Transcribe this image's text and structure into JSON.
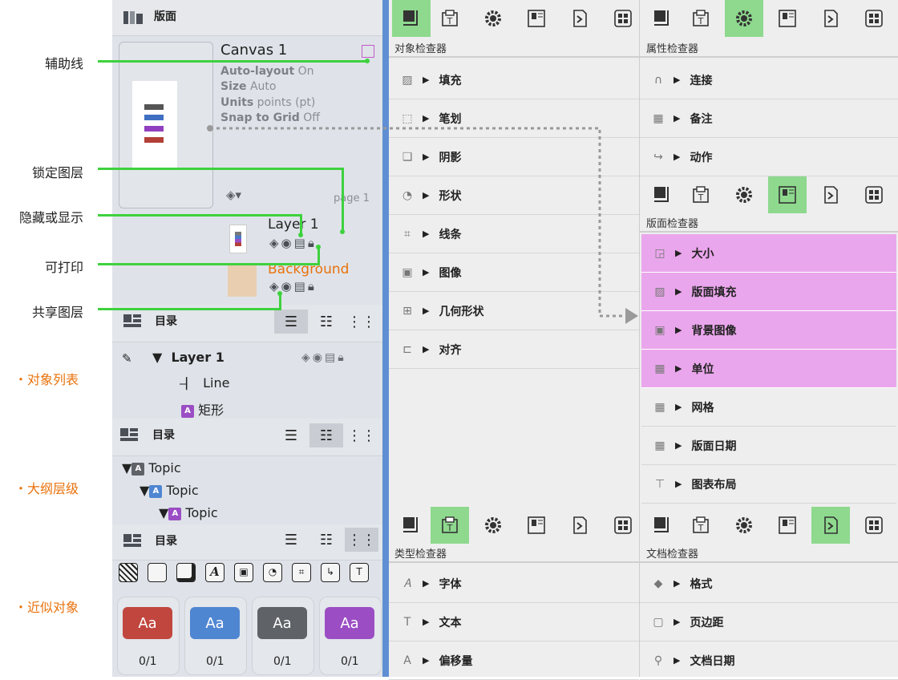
{
  "colors": {
    "green": "#3ed13e",
    "pink": "#eaa6ec",
    "blue_divider": "#5f8fd3",
    "orange": "#e8720c",
    "toolbar_active": "#8ed98e"
  },
  "callouts": {
    "guides": "辅助线",
    "lock_layer": "锁定图层",
    "hide_show": "隐藏或显示",
    "printable": "可打印",
    "shared_layer": "共享图层",
    "object_list": "・对象列表",
    "outline_level": "・大纲层级",
    "similar_objects": "・近似对象"
  },
  "canvases": {
    "header": "版面",
    "canvas_name": "Canvas 1",
    "auto_layout_key": "Auto-layout",
    "auto_layout_val": "On",
    "size_key": "Size",
    "size_val": "Auto",
    "units_key": "Units",
    "units_val": "points (pt)",
    "snap_key": "Snap to Grid",
    "snap_val": "Off",
    "page_label": "page 1",
    "layer1": "Layer 1",
    "background": "Background"
  },
  "contents": {
    "header": "目录",
    "layer_row": "Layer 1",
    "line_item": "Line",
    "rect_item": "矩形",
    "rect_badge": "A"
  },
  "outline": {
    "header": "目录",
    "topic1": "Topic",
    "topic2": "Topic",
    "topic3": "Topic",
    "badge": "A"
  },
  "similar": {
    "header": "目录",
    "swatch_text": "Aa",
    "counts": [
      "0/1",
      "0/1",
      "0/1",
      "0/1"
    ],
    "swatch_colors": [
      "#c0463e",
      "#4f86d2",
      "#5f6267",
      "#9b4ec4"
    ]
  },
  "object_inspector": {
    "caption": "对象检查器",
    "rows": [
      "填充",
      "笔划",
      "阴影",
      "形状",
      "线条",
      "图像",
      "几何形状",
      "对齐"
    ],
    "row_icons": [
      "fill-icon",
      "stroke-icon",
      "shadow-icon",
      "shape-icon",
      "lines-icon",
      "image-icon",
      "geometry-icon",
      "align-icon"
    ]
  },
  "properties_inspector": {
    "caption": "属性检查器",
    "rows": [
      "连接",
      "备注",
      "动作"
    ],
    "row_icons": [
      "magnet-icon",
      "note-icon",
      "action-icon"
    ]
  },
  "canvas_inspector": {
    "caption": "版面检查器",
    "rows": [
      "大小",
      "版面填充",
      "背景图像",
      "单位",
      "网格",
      "版面日期",
      "图表布局"
    ],
    "row_icons": [
      "size-icon",
      "canvas-fill-icon",
      "background-image-icon",
      "units-icon",
      "grid-icon",
      "canvas-date-icon",
      "diagram-layout-icon"
    ],
    "highlighted_count": 4
  },
  "type_inspector": {
    "caption": "类型检查器",
    "rows": [
      "字体",
      "文本",
      "偏移量"
    ],
    "row_icons": [
      "font-icon",
      "text-icon",
      "offset-icon"
    ]
  },
  "document_inspector": {
    "caption": "文档检查器",
    "rows": [
      "格式",
      "页边距",
      "文档日期"
    ],
    "row_icons": [
      "format-icon",
      "margins-icon",
      "document-date-icon"
    ]
  }
}
